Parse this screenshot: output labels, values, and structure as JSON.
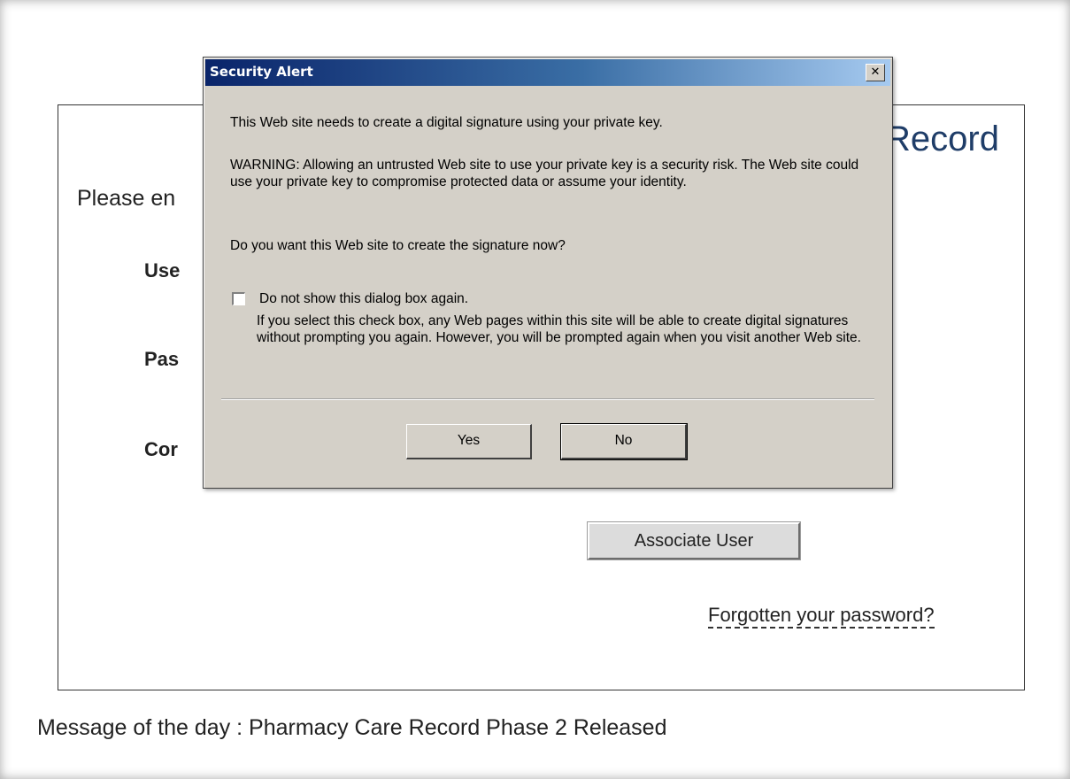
{
  "page": {
    "record_title_fragment": "Record",
    "prompt_fragment": "Please en",
    "field_label_fragments": [
      "Use",
      "Pas",
      "Cor"
    ],
    "associate_button_label": "Associate User",
    "forgot_password_link": "Forgotten your password?",
    "message_of_the_day": "Message of the day : Pharmacy Care Record Phase 2 Released"
  },
  "dialog": {
    "title": "Security Alert",
    "close_glyph": "✕",
    "intro": "This Web site needs to create a digital signature using your private key.",
    "warning": "WARNING: Allowing an untrusted Web site to use your private key is a security risk. The Web site could use your private key to compromise protected data or assume your identity.",
    "question": "Do you want this Web site to create the signature now?",
    "checkbox_label": "Do not show this dialog box again.",
    "checkbox_checked": false,
    "checkbox_note": "If you select this check box, any Web pages within this site will be able to create digital signatures without prompting you again. However, you will be prompted again when you visit another Web site.",
    "yes_label": "Yes",
    "no_label": "No"
  },
  "colors": {
    "title_bar_start": "#0a246a",
    "title_bar_end": "#a6caf0",
    "dialog_face": "#d4d0c8",
    "record_title_color": "#1f3d68"
  }
}
